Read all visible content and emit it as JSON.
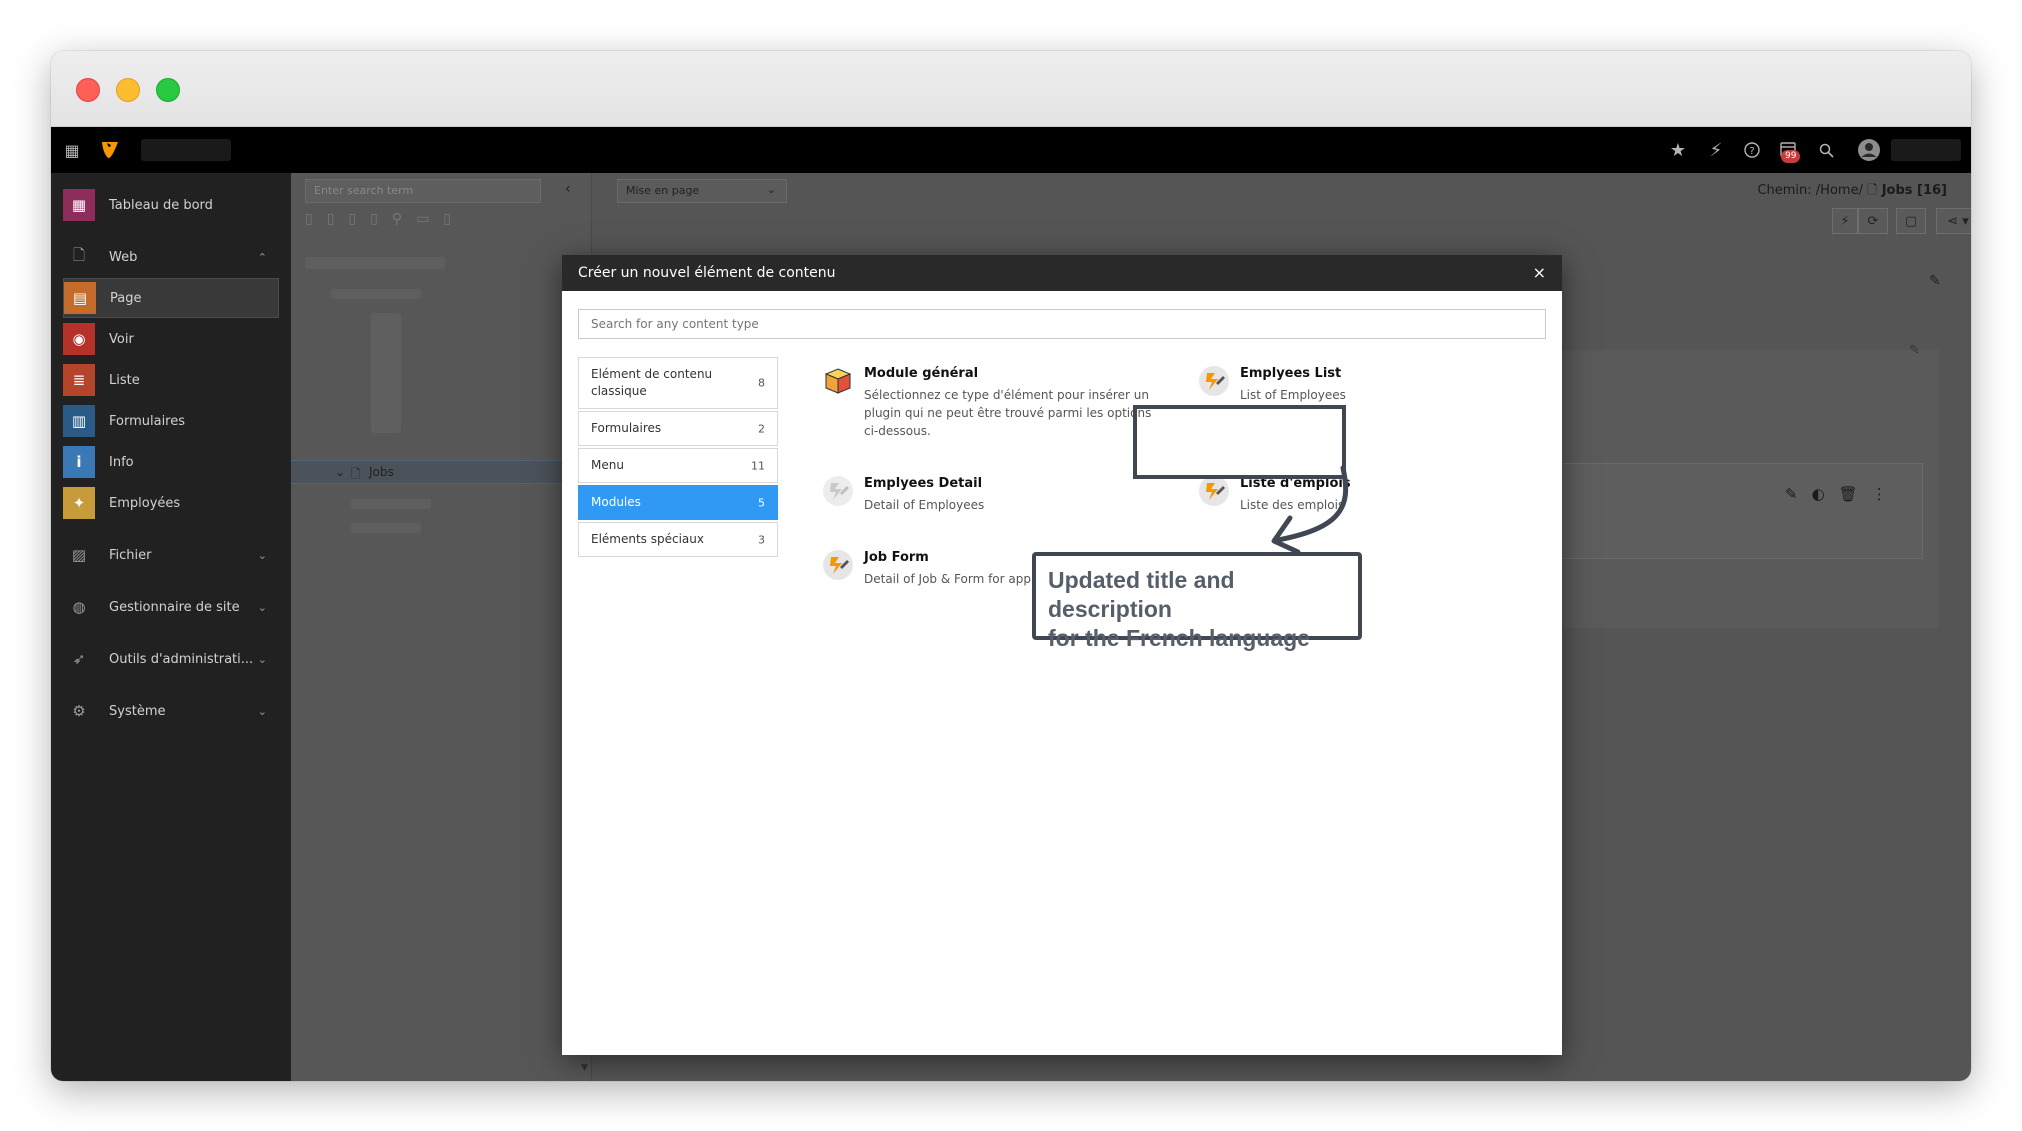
{
  "sidebar": {
    "items": [
      {
        "label": "Tableau de bord",
        "icon": "dashboard-icon",
        "color": "#8e2c5c"
      },
      {
        "label": "Web",
        "icon": "web-page-icon"
      },
      {
        "label": "Page",
        "icon": "page-module-icon",
        "color": "#c46c2b"
      },
      {
        "label": "Voir",
        "icon": "eye-icon",
        "color": "#b5312a"
      },
      {
        "label": "Liste",
        "icon": "list-icon",
        "color": "#b5452a"
      },
      {
        "label": "Formulaires",
        "icon": "form-icon",
        "color": "#2a5b86"
      },
      {
        "label": "Info",
        "icon": "info-icon",
        "color": "#3a79b5"
      },
      {
        "label": "Employées",
        "icon": "employees-extension-icon",
        "color": "#c79b3a"
      },
      {
        "label": "Fichier",
        "icon": "file-icon"
      },
      {
        "label": "Gestionnaire de site",
        "icon": "globe-icon"
      },
      {
        "label": "Outils d'administrati...",
        "icon": "rocket-icon"
      },
      {
        "label": "Système",
        "icon": "gear-icon"
      }
    ]
  },
  "topbar": {
    "notification_count": "99"
  },
  "tree": {
    "search_placeholder": "Enter search term",
    "selected_node": "Jobs"
  },
  "content": {
    "layout_select": "Mise en page",
    "path_prefix": "Chemin: /Home/",
    "page_title": "Jobs [16]"
  },
  "modal": {
    "title": "Créer un nouvel élément de contenu",
    "close_label": "×",
    "search_placeholder": "Search for any content type",
    "categories": [
      {
        "label": "Elément de contenu classique",
        "count": "8"
      },
      {
        "label": "Formulaires",
        "count": "2"
      },
      {
        "label": "Menu",
        "count": "11"
      },
      {
        "label": "Modules",
        "count": "5"
      },
      {
        "label": "Eléments spéciaux",
        "count": "3"
      }
    ],
    "elements": [
      {
        "title": "Module général",
        "description": "Sélectionnez ce type d'élément pour insérer un plugin qui ne peut être trouvé parmi les options ci-dessous.",
        "icon": "cube-icon"
      },
      {
        "title": "Emplyees List",
        "description": "List of Employees",
        "icon": "extension-plugin-icon"
      },
      {
        "title": "Emplyees Detail",
        "description": "Detail of Employees",
        "icon": "extension-plugin-icon-grey"
      },
      {
        "title": "Liste d'emplois",
        "description": "Liste des emplois",
        "icon": "extension-plugin-icon"
      },
      {
        "title": "Job Form",
        "description": "Detail of Job & Form for apply",
        "icon": "extension-plugin-icon"
      }
    ]
  },
  "annotation": {
    "line1": "Updated title and description",
    "line2": "for the French language"
  }
}
